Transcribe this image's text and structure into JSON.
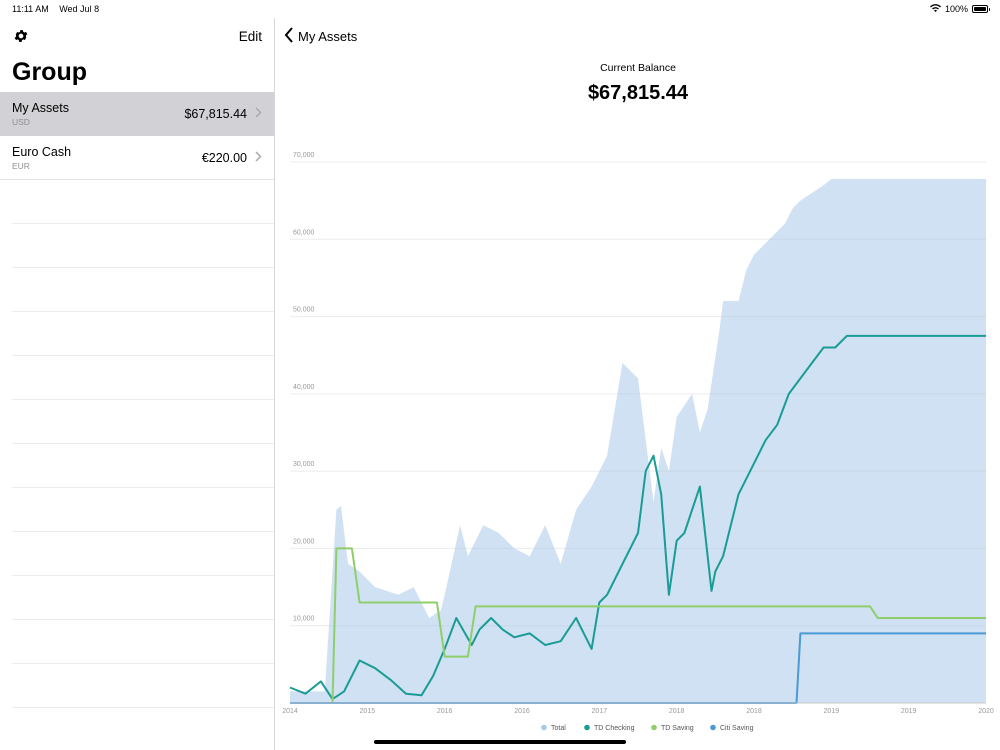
{
  "status": {
    "time": "11:11 AM",
    "date": "Wed Jul 8",
    "battery": "100%",
    "battery_level": 1.0
  },
  "sidebar": {
    "edit_label": "Edit",
    "title": "Group",
    "groups": [
      {
        "name": "My Assets",
        "currency": "USD",
        "amount": "$67,815.44",
        "selected": true
      },
      {
        "name": "Euro Cash",
        "currency": "EUR",
        "amount": "€220.00",
        "selected": false
      }
    ]
  },
  "main": {
    "back_label": "My Assets",
    "balance_caption": "Current Balance",
    "balance_value": "$67,815.44"
  },
  "colors": {
    "total": "#a8c8e8",
    "td_checking": "#1a9c94",
    "td_saving": "#8fce6a",
    "citi_saving": "#4a9ad6"
  },
  "chart_data": {
    "type": "area",
    "ylim": [
      0,
      70000
    ],
    "y_ticks": [
      "10,000",
      "20,000",
      "30,000",
      "40,000",
      "50,000",
      "60,000",
      "70,000"
    ],
    "y_tick_values": [
      10000,
      20000,
      30000,
      40000,
      50000,
      60000,
      70000
    ],
    "x_ticks": [
      "2014",
      "2015",
      "2016",
      "2016",
      "2017",
      "2018",
      "2018",
      "2019",
      "2019",
      "2020"
    ],
    "x_range": [
      0,
      9
    ],
    "legend": [
      "Total",
      "TD Checking",
      "TD Saving",
      "Citi Saving"
    ],
    "series": [
      {
        "name": "Total",
        "x": [
          0,
          0.2,
          0.45,
          0.6,
          0.66,
          0.75,
          0.9,
          1.1,
          1.4,
          1.6,
          1.8,
          1.95,
          2.0,
          2.2,
          2.3,
          2.4,
          2.5,
          2.7,
          2.9,
          3.1,
          3.3,
          3.5,
          3.7,
          3.9,
          4.1,
          4.3,
          4.5,
          4.7,
          4.8,
          4.9,
          5.0,
          5.2,
          5.3,
          5.4,
          5.55,
          5.6,
          5.8,
          5.9,
          6.0,
          6.2,
          6.4,
          6.5,
          6.6,
          6.75,
          6.9,
          7.0,
          7.2,
          7.4,
          7.6,
          7.8,
          8.0,
          8.2,
          8.4,
          8.6,
          8.8,
          9.0
        ],
        "values": [
          1500,
          1500,
          1500,
          25000,
          25500,
          18000,
          17000,
          15000,
          14000,
          15000,
          11000,
          12000,
          14000,
          23000,
          19000,
          21000,
          23000,
          22000,
          20000,
          19000,
          23000,
          18000,
          25000,
          28000,
          32000,
          44000,
          42000,
          26000,
          33000,
          30000,
          37000,
          40000,
          35000,
          38000,
          48000,
          52000,
          52000,
          56000,
          58000,
          60000,
          62000,
          64000,
          65000,
          66000,
          67000,
          67800,
          67800,
          67800,
          67800,
          67800,
          67800,
          67800,
          67800,
          67800,
          67800,
          67800
        ]
      },
      {
        "name": "TD Checking",
        "x": [
          0,
          0.2,
          0.4,
          0.55,
          0.7,
          0.9,
          1.1,
          1.3,
          1.5,
          1.7,
          1.85,
          2.0,
          2.15,
          2.35,
          2.45,
          2.6,
          2.75,
          2.9,
          3.1,
          3.3,
          3.5,
          3.7,
          3.9,
          4.0,
          4.1,
          4.3,
          4.5,
          4.6,
          4.7,
          4.8,
          4.9,
          5.0,
          5.1,
          5.2,
          5.3,
          5.45,
          5.5,
          5.6,
          5.8,
          6.0,
          6.15,
          6.3,
          6.45,
          6.6,
          6.75,
          6.9,
          7.05,
          7.2,
          7.4,
          7.6,
          7.8,
          8.0,
          8.2,
          8.4,
          8.6,
          8.8,
          9.0
        ],
        "values": [
          2000,
          1200,
          2800,
          500,
          1500,
          5500,
          4500,
          3000,
          1200,
          1000,
          3500,
          7000,
          11000,
          7500,
          9500,
          11000,
          9500,
          8500,
          9000,
          7500,
          8000,
          11000,
          7000,
          13000,
          14000,
          18000,
          22000,
          30000,
          32000,
          27000,
          14000,
          21000,
          22000,
          25000,
          28000,
          14500,
          17000,
          19000,
          27000,
          31000,
          34000,
          36000,
          40000,
          42000,
          44000,
          46000,
          46000,
          47500,
          47500,
          47500,
          47500,
          47500,
          47500,
          47500,
          47500,
          47500,
          47500
        ]
      },
      {
        "name": "TD Saving",
        "x": [
          0,
          0.55,
          0.6,
          0.65,
          0.8,
          0.9,
          1.9,
          2.0,
          2.3,
          2.4,
          3.0,
          4.0,
          5.0,
          6.0,
          7.0,
          7.5,
          7.6,
          8.0,
          9.0
        ],
        "values": [
          0,
          0,
          20000,
          20000,
          20000,
          13000,
          13000,
          6000,
          6000,
          12500,
          12500,
          12500,
          12500,
          12500,
          12500,
          12500,
          11000,
          11000,
          11000
        ]
      },
      {
        "name": "Citi Saving",
        "x": [
          0,
          6.5,
          6.55,
          6.6,
          7.0,
          8.0,
          9.0
        ],
        "values": [
          0,
          0,
          0,
          9000,
          9000,
          9000,
          9000
        ]
      }
    ]
  }
}
